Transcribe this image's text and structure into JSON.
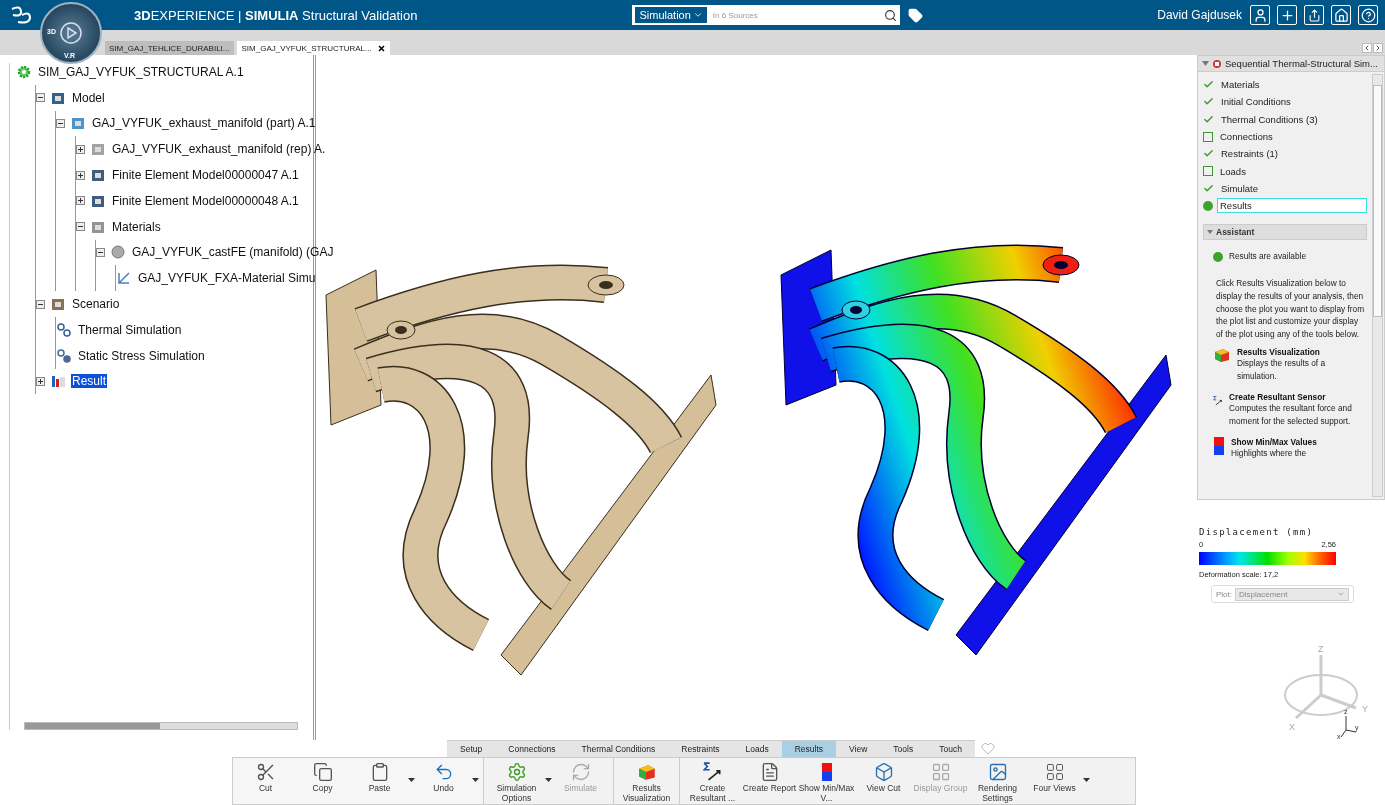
{
  "header": {
    "title": "**3D**EXPERIENCE | **SIMULIA** Structural Validation",
    "compass_labels": [
      "3D",
      "V.R"
    ],
    "search": {
      "scope": "Simulation",
      "placeholder": "In 6 Sources"
    },
    "user": "David Gajdusek"
  },
  "doc_tabs": [
    {
      "label": "SIM_GAJ_TEHLICE_DURABILI...",
      "selected": false
    },
    {
      "label": "SIM_GAJ_VYFUK_STRUCTURAL...",
      "selected": true
    }
  ],
  "tree": {
    "label": "SIM_GAJ_VYFUK_STRUCTURAL A.1",
    "kind": "gear",
    "selected": false,
    "children": [
      {
        "label": "Model",
        "kind": "model",
        "expanded": true,
        "selected": false,
        "children": [
          {
            "label": "GAJ_VYFUK_exhaust_manifold (part) A.1",
            "kind": "part",
            "expanded": true,
            "selected": false,
            "children": [
              {
                "label": "GAJ_VYFUK_exhaust_manifold (rep) A.",
                "kind": "rep",
                "expanded": false,
                "selected": false
              },
              {
                "label": "Finite Element Model00000047 A.1",
                "kind": "fem",
                "expanded": false,
                "selected": false
              },
              {
                "label": "Finite Element Model00000048 A.1",
                "kind": "fem",
                "expanded": false,
                "selected": false
              },
              {
                "label": "Materials",
                "kind": "materials",
                "expanded": true,
                "selected": false,
                "children": [
                  {
                    "label": "GAJ_VYFUK_castFE (manifold) (GAJ",
                    "kind": "material",
                    "expanded": true,
                    "selected": false,
                    "children": [
                      {
                        "label": "GAJ_VYFUK_FXA-Material Simu",
                        "kind": "material-sim",
                        "selected": false
                      }
                    ]
                  }
                ]
              }
            ]
          }
        ]
      },
      {
        "label": "Scenario",
        "kind": "scenario",
        "expanded": true,
        "selected": false,
        "children": [
          {
            "label": "Thermal Simulation",
            "kind": "thermal",
            "selected": false
          },
          {
            "label": "Static Stress Simulation",
            "kind": "stress",
            "selected": false
          }
        ]
      },
      {
        "label": "Result",
        "kind": "result",
        "expanded": false,
        "selected": true
      }
    ]
  },
  "workflow": {
    "title": "Sequential Thermal-Structural Sim...",
    "steps": [
      {
        "label": "Materials",
        "done": true,
        "current": false,
        "selected": false
      },
      {
        "label": "Initial Conditions",
        "done": true,
        "current": false,
        "selected": false
      },
      {
        "label": "Thermal Conditions (3)",
        "done": true,
        "current": false,
        "selected": false
      },
      {
        "label": "Connections",
        "done": false,
        "current": false,
        "selected": false
      },
      {
        "label": "Restraints (1)",
        "done": true,
        "current": false,
        "selected": false
      },
      {
        "label": "Loads",
        "done": false,
        "current": false,
        "selected": false
      },
      {
        "label": "Simulate",
        "done": true,
        "current": false,
        "selected": false
      },
      {
        "label": "Results",
        "current": true,
        "selected": true
      }
    ]
  },
  "assistant": {
    "title": "Assistant",
    "status": "Results are available",
    "intro": "Click Results Visualization below to display the results of your analysis, then choose the plot you want to display from the plot list and customize your display of the plot using any of the tools below.",
    "tools": [
      {
        "kind": "results-visualization",
        "title": "Results Visualization",
        "description": "Displays the results of a simulation."
      },
      {
        "kind": "resultant-sensor",
        "title": "Create Resultant Sensor",
        "description": "Computes the resultant force and moment for the selected support."
      },
      {
        "kind": "min-max",
        "title": "Show Min/Max Values",
        "description": "Highlights where the"
      }
    ]
  },
  "legend": {
    "title": "Displacement (mm)",
    "min": "0",
    "max": "2,56",
    "deformation": "Deformation scale: 17,2",
    "plot_label": "Plot:",
    "plot_value": "Displacement"
  },
  "triad": {
    "axes": [
      "Z",
      "Y",
      "X"
    ],
    "mini_axes": [
      "z",
      "y",
      "x"
    ]
  },
  "ribbon_tabs": [
    {
      "label": "Setup",
      "selected": false
    },
    {
      "label": "Connections",
      "selected": false
    },
    {
      "label": "Thermal Conditions",
      "selected": false
    },
    {
      "label": "Restraints",
      "selected": false
    },
    {
      "label": "Loads",
      "selected": false
    },
    {
      "label": "Results",
      "selected": true
    },
    {
      "label": "View",
      "selected": false
    },
    {
      "label": "Tools",
      "selected": false
    },
    {
      "label": "Touch",
      "selected": false
    }
  ],
  "toolbar": [
    [
      {
        "kind": "cut",
        "label": "Cut",
        "disabled": false,
        "dropdown": false
      },
      {
        "kind": "copy",
        "label": "Copy",
        "disabled": false,
        "dropdown": false
      },
      {
        "kind": "paste",
        "label": "Paste",
        "disabled": false,
        "dropdown": true
      },
      {
        "kind": "undo",
        "label": "Undo",
        "disabled": false,
        "dropdown": true
      }
    ],
    [
      {
        "kind": "options",
        "label": "Simulation Options",
        "disabled": false,
        "dropdown": true
      },
      {
        "kind": "simulate",
        "label": "Simulate",
        "disabled": true,
        "dropdown": false
      }
    ],
    [
      {
        "kind": "results",
        "label": "Results Visualization",
        "disabled": false,
        "dropdown": false
      }
    ],
    [
      {
        "kind": "sensor",
        "label": "Create Resultant ...",
        "disabled": false,
        "dropdown": false
      },
      {
        "kind": "report",
        "label": "Create Report",
        "disabled": false,
        "dropdown": false
      },
      {
        "kind": "minmax",
        "label": "Show Min/Max V...",
        "disabled": false,
        "dropdown": false
      },
      {
        "kind": "viewcut",
        "label": "View Cut",
        "disabled": false,
        "dropdown": false
      },
      {
        "kind": "group",
        "label": "Display Group",
        "disabled": true,
        "dropdown": false
      },
      {
        "kind": "rendering",
        "label": "Rendering Settings",
        "disabled": false,
        "dropdown": false
      },
      {
        "kind": "fourviews",
        "label": "Four Views",
        "disabled": false,
        "dropdown": true
      }
    ]
  ]
}
